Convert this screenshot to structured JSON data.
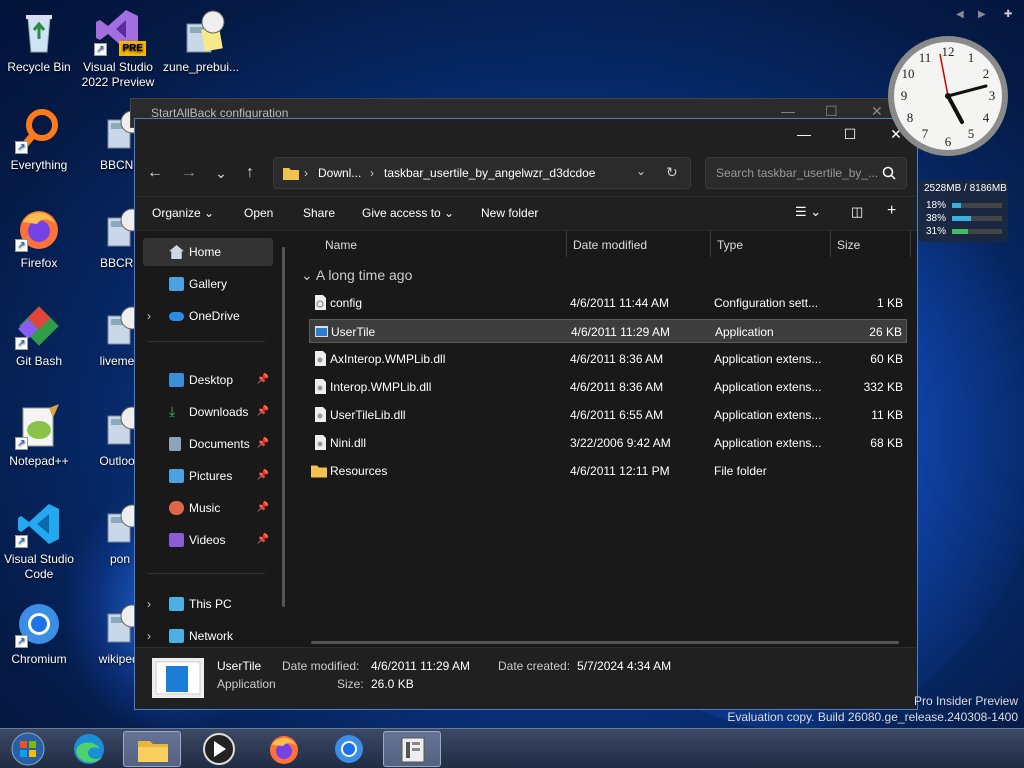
{
  "desktop": {
    "icons": [
      {
        "label": "Recycle Bin",
        "icon": "recycle-bin-icon"
      },
      {
        "label": "Visual Studio 2022 Preview",
        "icon": "visual-studio-icon",
        "badge": "PRE"
      },
      {
        "label": "zune_prebui...",
        "icon": "calculator-clock-icon"
      },
      {
        "label": "Everything",
        "icon": "search-magnifier-icon"
      },
      {
        "label": "BBCNe",
        "icon": "calculator-clock-icon"
      },
      {
        "label": "Firefox",
        "icon": "firefox-icon"
      },
      {
        "label": "BBCRa",
        "icon": "calculator-clock-icon"
      },
      {
        "label": "Git Bash",
        "icon": "git-icon"
      },
      {
        "label": "livemes",
        "icon": "calculator-clock-icon"
      },
      {
        "label": "Notepad++",
        "icon": "notepad-plus-plus-icon"
      },
      {
        "label": "Outlook",
        "icon": "calculator-clock-icon"
      },
      {
        "label": "Visual Studio Code",
        "icon": "vscode-icon"
      },
      {
        "label": "pon",
        "icon": "calculator-clock-icon"
      },
      {
        "label": "Chromium",
        "icon": "chromium-icon"
      },
      {
        "label": "wikipedi",
        "icon": "calculator-clock-icon"
      }
    ]
  },
  "background_window": {
    "title": "StartAllBack configuration"
  },
  "explorer": {
    "window_controls": {
      "minimize": "—",
      "maximize": "☐",
      "close": "✕"
    },
    "nav": {
      "back": "←",
      "forward": "→",
      "recent": "⌄",
      "up": "↑"
    },
    "address": {
      "segments": [
        "Downl...",
        "taskbar_usertile_by_angelwzr_d3dcdoe"
      ],
      "separator": "›"
    },
    "search": {
      "placeholder": "Search taskbar_usertile_by_..."
    },
    "toolbar": {
      "organize": "Organize",
      "open": "Open",
      "share": "Share",
      "give_access": "Give access to",
      "new_folder": "New folder"
    },
    "sidebar": {
      "home": "Home",
      "gallery": "Gallery",
      "onedrive": "OneDrive",
      "pinned": [
        {
          "label": "Desktop",
          "color": "#3a8fd9"
        },
        {
          "label": "Downloads",
          "color": "#3cb371"
        },
        {
          "label": "Documents",
          "color": "#8fa3bf"
        },
        {
          "label": "Pictures",
          "color": "#4aa3e0"
        },
        {
          "label": "Music",
          "color": "#e0664a"
        },
        {
          "label": "Videos",
          "color": "#8a5cd6"
        }
      ],
      "this_pc": "This PC",
      "network": "Network"
    },
    "columns": {
      "name": "Name",
      "date": "Date modified",
      "type": "Type",
      "size": "Size"
    },
    "group_label": "A long time ago",
    "files": [
      {
        "name": "config",
        "date": "4/6/2011 11:44 AM",
        "type": "Configuration sett...",
        "size": "1 KB",
        "kind": "doc"
      },
      {
        "name": "UserTile",
        "date": "4/6/2011 11:29 AM",
        "type": "Application",
        "size": "26 KB",
        "kind": "app"
      },
      {
        "name": "AxInterop.WMPLib.dll",
        "date": "4/6/2011 8:36 AM",
        "type": "Application extens...",
        "size": "60 KB",
        "kind": "dll"
      },
      {
        "name": "Interop.WMPLib.dll",
        "date": "4/6/2011 8:36 AM",
        "type": "Application extens...",
        "size": "332 KB",
        "kind": "dll"
      },
      {
        "name": "UserTileLib.dll",
        "date": "4/6/2011 6:55 AM",
        "type": "Application extens...",
        "size": "11 KB",
        "kind": "dll"
      },
      {
        "name": "Nini.dll",
        "date": "3/22/2006 9:42 AM",
        "type": "Application extens...",
        "size": "68 KB",
        "kind": "dll"
      },
      {
        "name": "Resources",
        "date": "4/6/2011 12:11 PM",
        "type": "File folder",
        "size": "",
        "kind": "folder"
      }
    ],
    "details": {
      "name": "UserTile",
      "type": "Application",
      "date_modified_label": "Date modified:",
      "date_modified": "4/6/2011 11:29 AM",
      "date_created_label": "Date created:",
      "date_created": "5/7/2024 4:34 AM",
      "size_label": "Size:",
      "size": "26.0 KB"
    }
  },
  "meter": {
    "memory": "2528MB / 8186MB",
    "rows": [
      {
        "label": "18%",
        "value": 0.18,
        "color": "#3ab0e0"
      },
      {
        "label": "38%",
        "value": 0.38,
        "color": "#3ab0e0"
      },
      {
        "label": "31%",
        "value": 0.31,
        "color": "#3cc060"
      }
    ]
  },
  "watermark": {
    "line1": "Pro Insider Preview",
    "line2": "Evaluation copy. Build 26080.ge_release.240308-1400"
  },
  "topnav": {
    "prev": "◀",
    "next": "▶",
    "add": "✚"
  },
  "taskbar": {
    "items": [
      "start-orb-icon",
      "edge-icon",
      "file-explorer-icon",
      "media-player-icon",
      "firefox-icon",
      "chromium-icon",
      "startallback-icon"
    ]
  },
  "colors": {
    "accent": "#4a7fd0",
    "selection": "#3d3d3d"
  }
}
